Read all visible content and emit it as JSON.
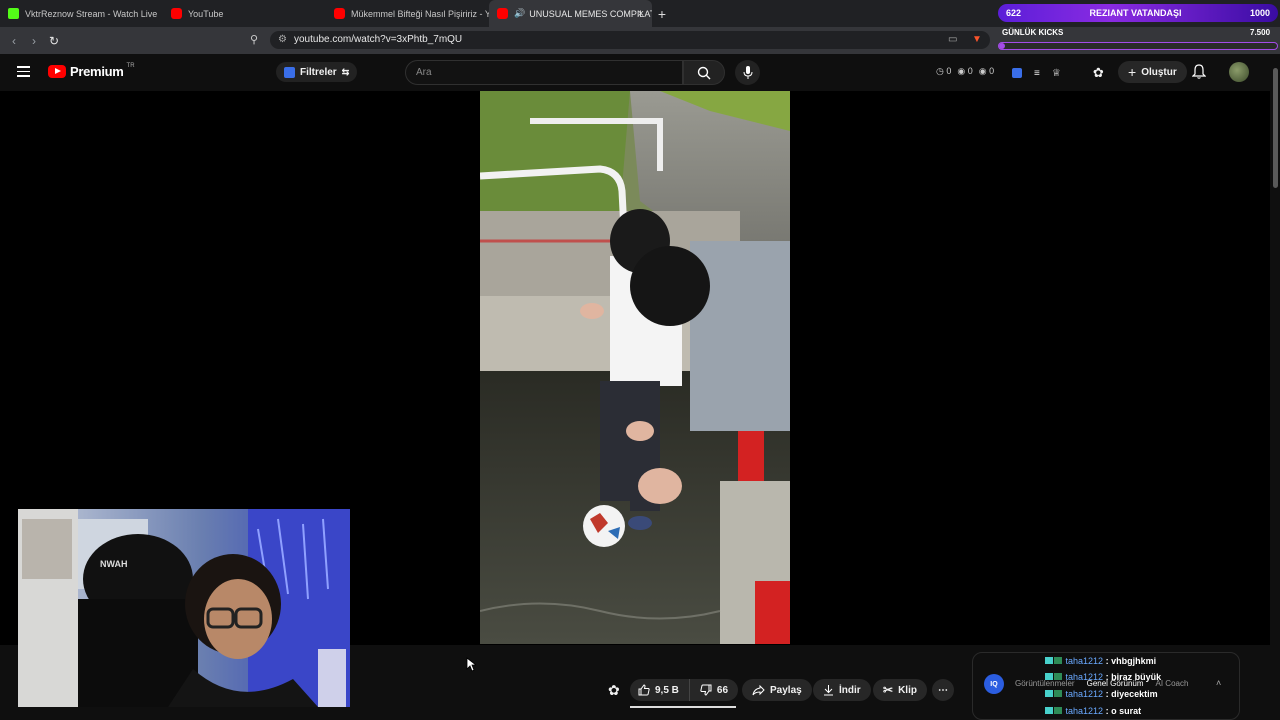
{
  "browser": {
    "tabs": [
      {
        "title": "VktrReznow Stream - Watch Live",
        "favicon": "kick-icon"
      },
      {
        "title": "YouTube",
        "favicon": "youtube-icon"
      },
      {
        "title": "Mükemmel Bifteği Nasıl Pişiririz - You",
        "favicon": "youtube-icon"
      },
      {
        "title": "UNUSUAL MEMES COMPILAT",
        "favicon": "youtube-icon",
        "active": true
      }
    ],
    "url": "youtube.com/watch?v=3xPhtb_7mQU"
  },
  "extension": {
    "left_value": "622",
    "center_label": "REZIANT VATANDAŞI",
    "right_value": "1000",
    "goal_label": "GÜNLÜK KICKS",
    "goal_value": "7.500",
    "goal_progress": 0.02
  },
  "youtube": {
    "logo_text": "Premium",
    "country": "TR",
    "filters_label": "Filtreler",
    "search_placeholder": "Ara",
    "stats": [
      "0",
      "0",
      "0"
    ],
    "create_label": "Oluştur"
  },
  "actions": {
    "likes": "9,5 B",
    "dislikes": "66",
    "share": "Paylaş",
    "download": "İndir",
    "clip": "Klip"
  },
  "chat": {
    "tabs": [
      "Görüntülenmeler",
      "Genel Görünüm",
      "AI Coach"
    ],
    "messages": [
      {
        "user": "taha1212",
        "text": ": vhbgjhkmi"
      },
      {
        "user": "taha1212",
        "text": ": biraz büyük"
      },
      {
        "user": "taha1212",
        "text": ": diyecektim"
      },
      {
        "user": "taha1212",
        "text": ": o surat"
      }
    ]
  },
  "colors": {
    "accent": "#ff0000",
    "kick": "#53fc18",
    "ext_purple": "#8a2be2",
    "chat_user": "#6aa9ff"
  }
}
